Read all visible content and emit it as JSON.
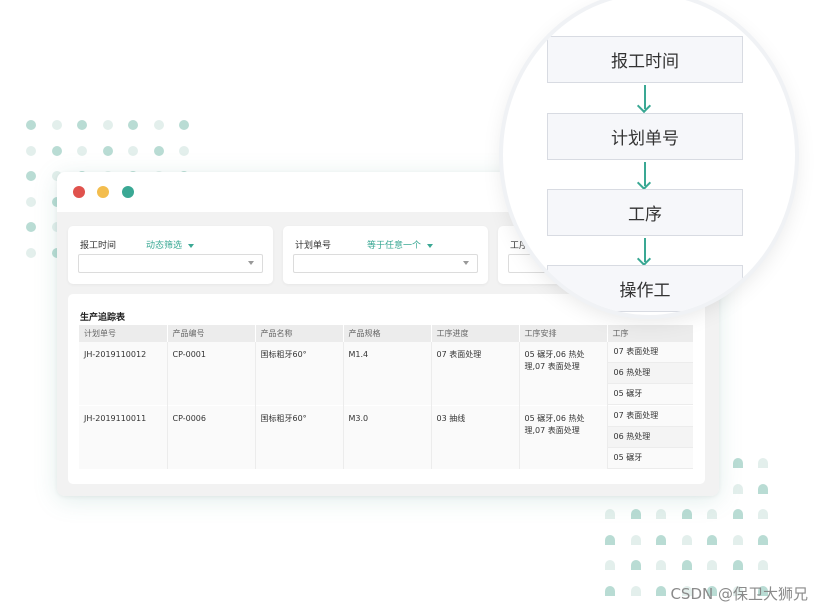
{
  "colors": {
    "accent": "#3aa894",
    "dot_light": "#e3efec",
    "dot_dark": "#b9dcd4",
    "traffic_red": "#e0524d",
    "traffic_yellow": "#f3bd4e",
    "traffic_green": "#3aa894"
  },
  "filters": [
    {
      "label": "报工时间",
      "mode": "动态筛选"
    },
    {
      "label": "计划单号",
      "mode": "等于任意一个"
    },
    {
      "label": "工序",
      "mode": ""
    }
  ],
  "table": {
    "title": "生产追踪表",
    "columns": [
      "计划单号",
      "产品编号",
      "产品名称",
      "产品规格",
      "工序进度",
      "工序安排",
      "工序"
    ],
    "rows": [
      {
        "plan_no": "JH-2019110012",
        "product_no": "CP-0001",
        "product_name": "国标粗牙60°",
        "spec": "M1.4",
        "progress": "07 表面处理",
        "arrangement": "05 碾牙,06 热处理,07 表面处理",
        "steps": [
          "07 表面处理",
          "06 热处理",
          "05 碾牙"
        ]
      },
      {
        "plan_no": "JH-2019110011",
        "product_no": "CP-0006",
        "product_name": "国标粗牙60°",
        "spec": "M3.0",
        "progress": "03 抽线",
        "arrangement": "05 碾牙,06 热处理,07 表面处理",
        "steps": [
          "07 表面处理",
          "06 热处理",
          "05 碾牙"
        ]
      }
    ]
  },
  "flow": [
    "报工时间",
    "计划单号",
    "工序",
    "操作工"
  ],
  "watermark": "CSDN @保卫大狮兄"
}
